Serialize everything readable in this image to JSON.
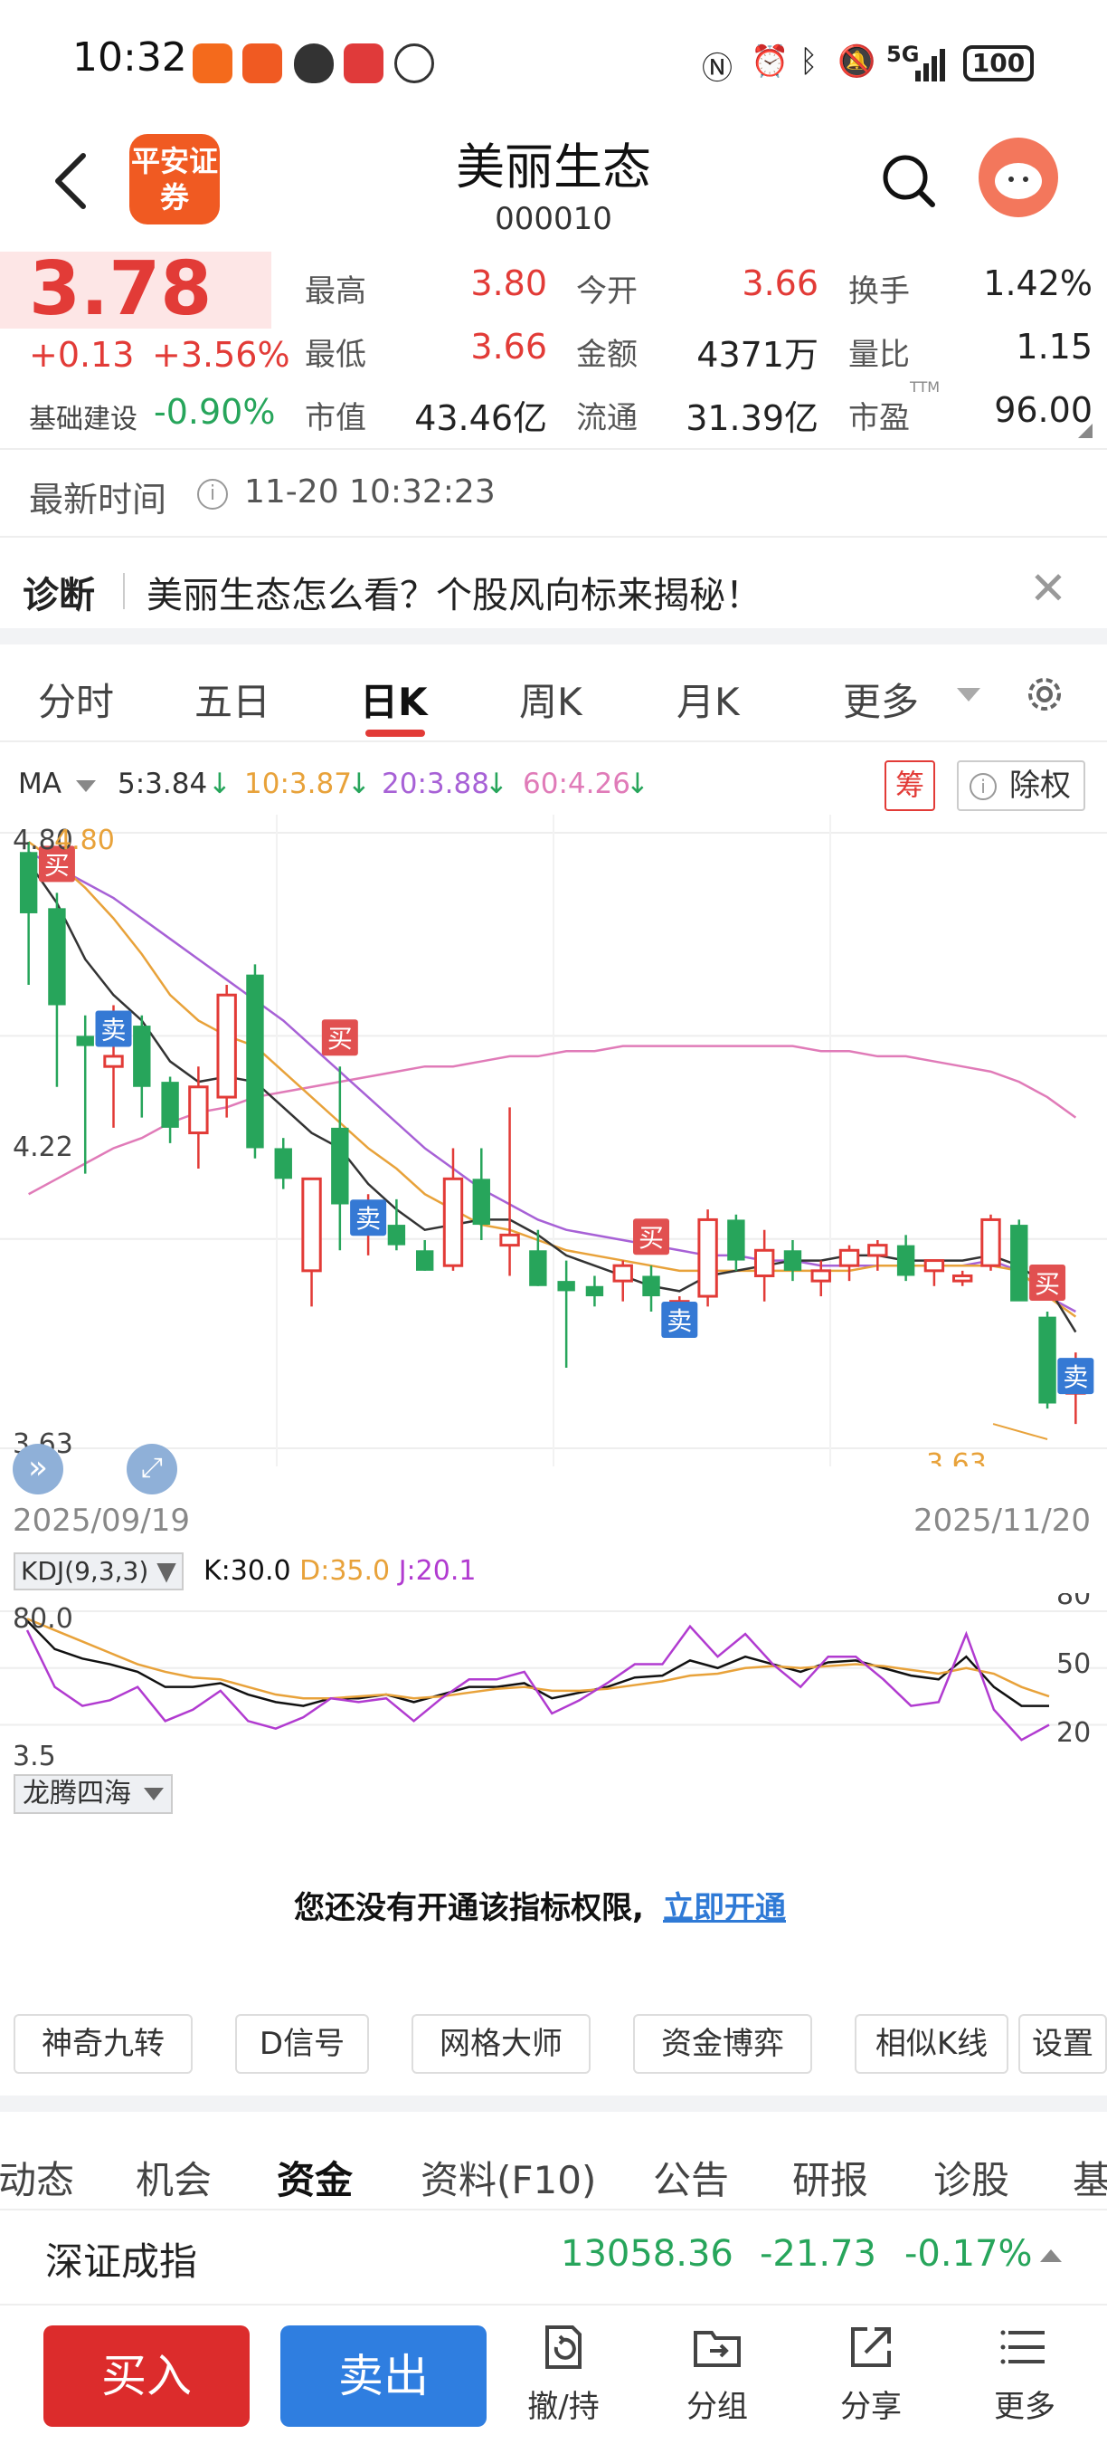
{
  "status_bar": {
    "time": "10:32",
    "network": "5G",
    "battery": "100"
  },
  "header": {
    "logo_text": "平安证券",
    "stock_name": "美丽生态",
    "stock_code": "000010"
  },
  "quote": {
    "price": "3.78",
    "change": "+0.13",
    "change_pct": "+3.56%",
    "sector_name": "基础建设",
    "sector_pct": "-0.90%",
    "fields": [
      {
        "label": "最高",
        "value": "3.80",
        "color": "red"
      },
      {
        "label": "今开",
        "value": "3.66",
        "color": "red"
      },
      {
        "label": "换手",
        "value": "1.42%",
        "color": "black"
      },
      {
        "label": "最低",
        "value": "3.66",
        "color": "red"
      },
      {
        "label": "金额",
        "value": "4371万",
        "color": "black"
      },
      {
        "label": "量比",
        "value": "1.15",
        "color": "black"
      },
      {
        "label": "市值",
        "value": "43.46亿",
        "color": "black"
      },
      {
        "label": "流通",
        "value": "31.39亿",
        "color": "black"
      },
      {
        "label": "市盈",
        "value": "96.00",
        "color": "black"
      }
    ],
    "pe_superscript": "TTM"
  },
  "latest_time": {
    "label": "最新时间",
    "value": "11-20 10:32:23"
  },
  "diagnosis": {
    "label": "诊断",
    "text": "美丽生态怎么看？个股风向标来揭秘！"
  },
  "chart_tabs": [
    "分时",
    "五日",
    "日K",
    "周K",
    "月K",
    "更多"
  ],
  "ma_legend": {
    "label": "MA",
    "items": [
      {
        "text": "5:3.84",
        "color": "#333333"
      },
      {
        "text": "10:3.87",
        "color": "#e8a23a"
      },
      {
        "text": "20:3.88",
        "color": "#a761d6"
      },
      {
        "text": "60:4.26",
        "color": "#e07bb8"
      }
    ],
    "chip_label": "筹",
    "ex_rights_label": "除权"
  },
  "kline": {
    "y_labels": {
      "top": "4.80",
      "mid": "4.22",
      "bottom": "3.63"
    },
    "max_annotation": "4.80",
    "min_annotation": "3.63",
    "start_date": "2025/09/19",
    "end_date": "2025/11/20",
    "buy_label": "买",
    "sell_label": "卖"
  },
  "kdj": {
    "label": "KDJ(9,3,3)",
    "k": "K:30.0",
    "d": "D:35.0",
    "j": "J:20.1",
    "y_top": "80.0",
    "y_bottom": "3.5",
    "right_levels": [
      "80",
      "50",
      "20"
    ]
  },
  "indicator": {
    "name": "龙腾四海",
    "permission_text": "您还没有开通该指标权限,",
    "permission_link": "立即开通"
  },
  "tools": [
    "神奇九转",
    "D信号",
    "网格大师",
    "资金博弈",
    "相似K线",
    "设置"
  ],
  "content_tabs": [
    "动态",
    "机会",
    "资金",
    "资料(F10)",
    "公告",
    "研报",
    "诊股",
    "基"
  ],
  "index": {
    "name": "深证成指",
    "value": "13058.36",
    "change": "-21.73",
    "pct": "-0.17%"
  },
  "bottom": {
    "buy": "买入",
    "sell": "卖出",
    "actions": [
      "撤/持",
      "分组",
      "分享",
      "更多"
    ]
  },
  "chart_data": [
    {
      "type": "candlestick",
      "title": "日K",
      "x_start": "2025/09/19",
      "x_end": "2025/11/20",
      "ylim": [
        3.63,
        4.8
      ],
      "candles": [
        {
          "o": 4.78,
          "h": 4.8,
          "l": 4.52,
          "c": 4.66
        },
        {
          "o": 4.67,
          "h": 4.7,
          "l": 4.32,
          "c": 4.48
        },
        {
          "o": 4.42,
          "h": 4.46,
          "l": 4.15,
          "c": 4.4
        },
        {
          "o": 4.36,
          "h": 4.48,
          "l": 4.24,
          "c": 4.38
        },
        {
          "o": 4.44,
          "h": 4.46,
          "l": 4.26,
          "c": 4.32
        },
        {
          "o": 4.33,
          "h": 4.34,
          "l": 4.21,
          "c": 4.24
        },
        {
          "o": 4.23,
          "h": 4.36,
          "l": 4.16,
          "c": 4.32
        },
        {
          "o": 4.3,
          "h": 4.52,
          "l": 4.26,
          "c": 4.5
        },
        {
          "o": 4.54,
          "h": 4.56,
          "l": 4.18,
          "c": 4.2
        },
        {
          "o": 4.2,
          "h": 4.22,
          "l": 4.12,
          "c": 4.14
        },
        {
          "o": 3.96,
          "h": 4.14,
          "l": 3.89,
          "c": 4.14
        },
        {
          "o": 4.24,
          "h": 4.36,
          "l": 4.0,
          "c": 4.09
        },
        {
          "o": 4.06,
          "h": 4.11,
          "l": 3.99,
          "c": 4.09
        },
        {
          "o": 4.05,
          "h": 4.1,
          "l": 4.0,
          "c": 4.01
        },
        {
          "o": 4.0,
          "h": 4.02,
          "l": 3.96,
          "c": 3.96
        },
        {
          "o": 3.97,
          "h": 4.2,
          "l": 3.96,
          "c": 4.14
        },
        {
          "o": 4.14,
          "h": 4.2,
          "l": 4.02,
          "c": 4.05
        },
        {
          "o": 4.01,
          "h": 4.28,
          "l": 3.95,
          "c": 4.03
        },
        {
          "o": 4.0,
          "h": 4.04,
          "l": 3.93,
          "c": 3.93
        },
        {
          "o": 3.94,
          "h": 3.98,
          "l": 3.77,
          "c": 3.92
        },
        {
          "o": 3.93,
          "h": 3.95,
          "l": 3.89,
          "c": 3.91
        },
        {
          "o": 3.94,
          "h": 3.98,
          "l": 3.9,
          "c": 3.97
        },
        {
          "o": 3.95,
          "h": 3.97,
          "l": 3.88,
          "c": 3.91
        },
        {
          "o": 3.89,
          "h": 3.91,
          "l": 3.88,
          "c": 3.9
        },
        {
          "o": 3.91,
          "h": 4.08,
          "l": 3.89,
          "c": 4.06
        },
        {
          "o": 4.06,
          "h": 4.07,
          "l": 3.96,
          "c": 3.98
        },
        {
          "o": 3.95,
          "h": 4.04,
          "l": 3.9,
          "c": 4.0
        },
        {
          "o": 4.0,
          "h": 4.02,
          "l": 3.94,
          "c": 3.96
        },
        {
          "o": 3.94,
          "h": 3.98,
          "l": 3.91,
          "c": 3.96
        },
        {
          "o": 3.97,
          "h": 4.01,
          "l": 3.94,
          "c": 4.0
        },
        {
          "o": 3.99,
          "h": 4.02,
          "l": 3.96,
          "c": 4.01
        },
        {
          "o": 4.01,
          "h": 4.03,
          "l": 3.94,
          "c": 3.95
        },
        {
          "o": 3.96,
          "h": 3.98,
          "l": 3.93,
          "c": 3.98
        },
        {
          "o": 3.94,
          "h": 3.96,
          "l": 3.93,
          "c": 3.95
        },
        {
          "o": 3.97,
          "h": 4.07,
          "l": 3.96,
          "c": 4.06
        },
        {
          "o": 4.05,
          "h": 4.06,
          "l": 3.91,
          "c": 3.9
        },
        {
          "o": 3.87,
          "h": 3.88,
          "l": 3.69,
          "c": 3.7
        },
        {
          "o": 3.72,
          "h": 3.8,
          "l": 3.66,
          "c": 3.78
        }
      ],
      "ma5": [
        4.76,
        4.68,
        4.57,
        4.5,
        4.45,
        4.37,
        4.33,
        4.34,
        4.33,
        4.28,
        4.23,
        4.2,
        4.13,
        4.08,
        4.04,
        4.05,
        4.06,
        4.06,
        4.03,
        3.99,
        3.97,
        3.95,
        3.93,
        3.92,
        3.95,
        3.96,
        3.97,
        3.98,
        3.98,
        3.99,
        3.99,
        3.98,
        3.98,
        3.98,
        3.99,
        3.97,
        3.93,
        3.84
      ],
      "ma10": [
        4.8,
        4.76,
        4.71,
        4.65,
        4.58,
        4.5,
        4.45,
        4.42,
        4.4,
        4.35,
        4.3,
        4.25,
        4.2,
        4.16,
        4.11,
        4.08,
        4.05,
        4.04,
        4.02,
        4.0,
        3.99,
        3.98,
        3.97,
        3.96,
        3.96,
        3.96,
        3.96,
        3.96,
        3.96,
        3.96,
        3.97,
        3.97,
        3.97,
        3.97,
        3.97,
        3.96,
        3.91,
        3.87
      ],
      "ma20": [
        4.78,
        4.75,
        4.72,
        4.69,
        4.65,
        4.61,
        4.57,
        4.53,
        4.49,
        4.45,
        4.4,
        4.35,
        4.3,
        4.25,
        4.2,
        4.16,
        4.12,
        4.09,
        4.06,
        4.04,
        4.03,
        4.02,
        4.01,
        4.0,
        3.99,
        3.99,
        3.98,
        3.98,
        3.97,
        3.97,
        3.97,
        3.97,
        3.97,
        3.97,
        3.98,
        3.96,
        3.91,
        3.88
      ],
      "ma60": [
        4.11,
        4.14,
        4.17,
        4.2,
        4.22,
        4.25,
        4.27,
        4.28,
        4.3,
        4.31,
        4.32,
        4.33,
        4.34,
        4.35,
        4.36,
        4.36,
        4.37,
        4.38,
        4.38,
        4.39,
        4.39,
        4.4,
        4.4,
        4.4,
        4.4,
        4.4,
        4.4,
        4.4,
        4.39,
        4.39,
        4.38,
        4.38,
        4.37,
        4.36,
        4.35,
        4.33,
        4.3,
        4.26
      ],
      "signals": [
        {
          "index": 1,
          "type": "buy"
        },
        {
          "index": 3,
          "type": "sell"
        },
        {
          "index": 11,
          "type": "buy"
        },
        {
          "index": 12,
          "type": "sell"
        },
        {
          "index": 22,
          "type": "buy"
        },
        {
          "index": 23,
          "type": "sell"
        },
        {
          "index": 36,
          "type": "buy"
        },
        {
          "index": 37,
          "type": "sell"
        }
      ]
    },
    {
      "type": "line",
      "title": "KDJ(9,3,3)",
      "ylim": [
        3.5,
        80.0
      ],
      "series": [
        {
          "name": "K",
          "values": [
            75,
            60,
            55,
            52,
            48,
            40,
            40,
            42,
            36,
            32,
            30,
            34,
            34,
            36,
            32,
            36,
            40,
            40,
            42,
            34,
            37,
            40,
            45,
            46,
            54,
            50,
            56,
            52,
            48,
            53,
            54,
            50,
            46,
            44,
            56,
            40,
            30,
            30
          ]
        },
        {
          "name": "D",
          "values": [
            76,
            70,
            64,
            58,
            52,
            48,
            45,
            44,
            40,
            36,
            34,
            34,
            35,
            36,
            34,
            35,
            37,
            39,
            40,
            38,
            38,
            39,
            41,
            43,
            46,
            47,
            50,
            51,
            50,
            51,
            52,
            51,
            49,
            47,
            50,
            47,
            40,
            35
          ]
        },
        {
          "name": "J",
          "values": [
            70,
            40,
            30,
            33,
            40,
            22,
            28,
            38,
            22,
            18,
            24,
            34,
            32,
            34,
            22,
            34,
            44,
            44,
            48,
            26,
            33,
            42,
            52,
            52,
            72,
            56,
            68,
            52,
            40,
            56,
            56,
            44,
            30,
            32,
            68,
            28,
            12,
            20
          ]
        }
      ]
    }
  ]
}
